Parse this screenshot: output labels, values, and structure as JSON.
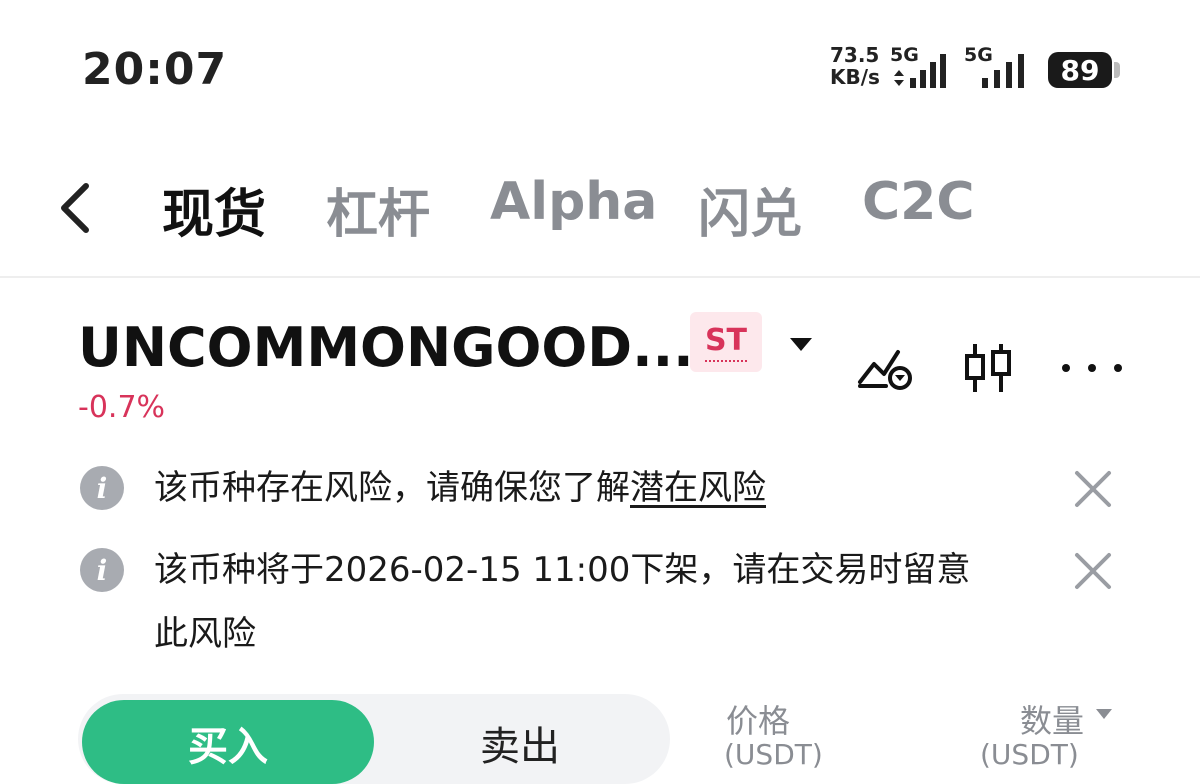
{
  "status_bar": {
    "time": "20:07",
    "net_speed_value": "73.5",
    "net_speed_unit": "KB/s",
    "sim1_label": "5G",
    "sim2_label": "5G",
    "battery": "89"
  },
  "tabs": [
    {
      "label": "现货",
      "active": true
    },
    {
      "label": "杠杆",
      "active": false
    },
    {
      "label": "Alpha",
      "active": false
    },
    {
      "label": "闪兑",
      "active": false
    },
    {
      "label": "C2C",
      "active": false
    }
  ],
  "pair": {
    "name": "UNCOMMONGOOD...",
    "badge": "ST",
    "change": "-0.7%"
  },
  "alerts": [
    {
      "text": "该币种存在风险，请确保您了解",
      "link": "潜在风险"
    },
    {
      "line1": "该币种将于2026-02-15 11:00下架，请在交易时留意",
      "line2": "此风险"
    }
  ],
  "trade": {
    "buy_label": "买入",
    "sell_label": "卖出"
  },
  "orderbook": {
    "price_label": "价格",
    "price_unit": "(USDT)",
    "qty_label": "数量",
    "qty_unit": "(USDT)"
  },
  "colors": {
    "buy_green": "#2ebd85",
    "down_red": "#d8335a"
  },
  "icons": [
    "back-chevron-icon",
    "price-alert-icon",
    "candlestick-icon",
    "more-icon",
    "info-icon",
    "close-icon",
    "dropdown-caret-icon"
  ]
}
